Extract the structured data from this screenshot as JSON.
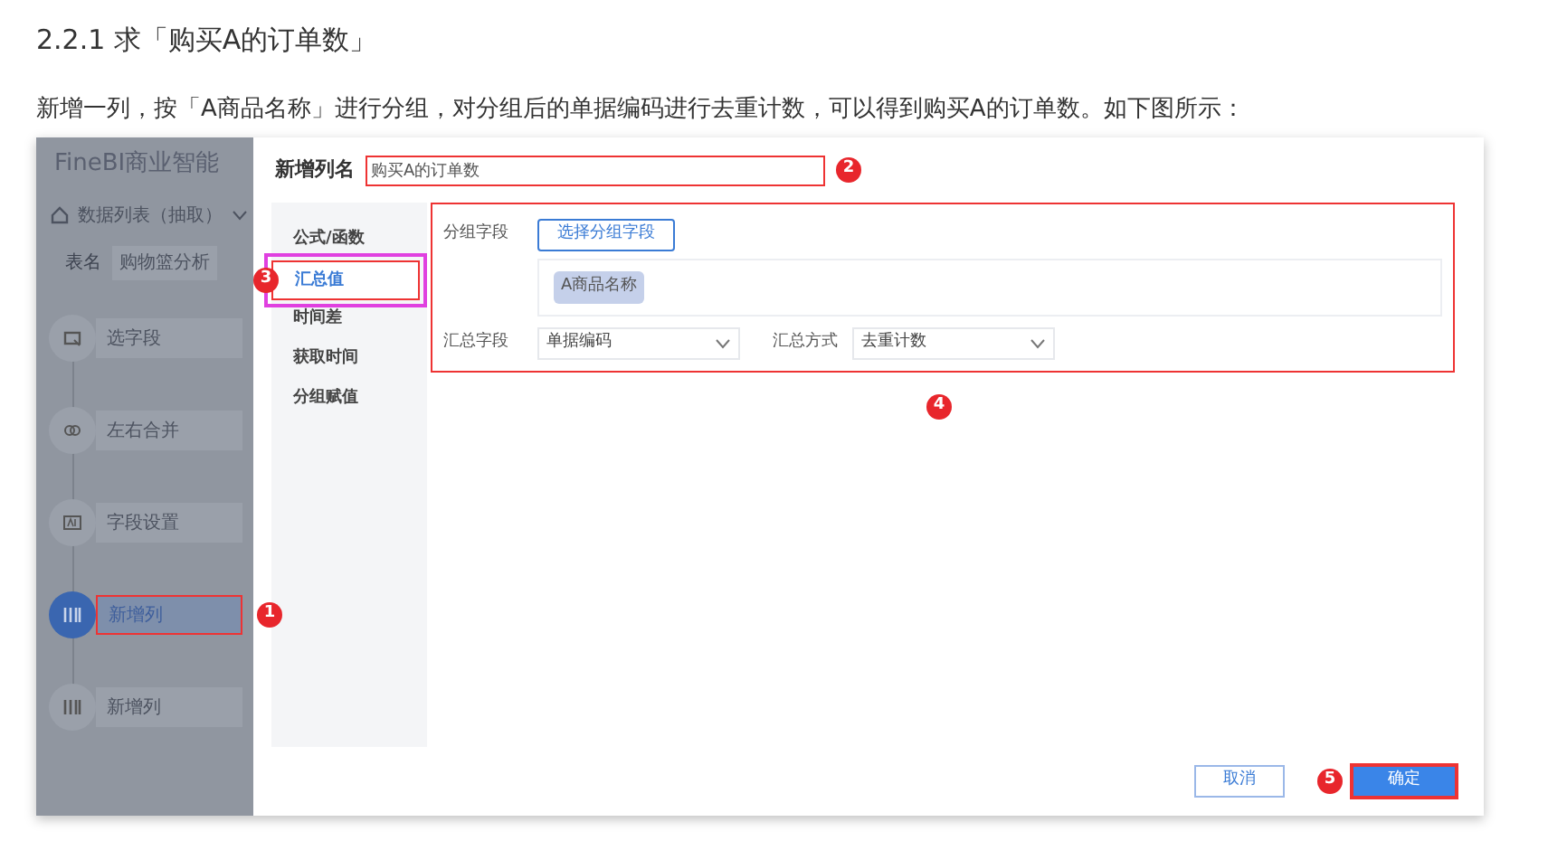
{
  "heading": "2.2.1 求「购买A的订单数」",
  "intro": "新增一列，按「A商品名称」进行分组，对分组后的单据编码进行去重计数，可以得到购买A的订单数。如下图所示：",
  "sidebar": {
    "brand": "FineBI商业智能",
    "dataset": "数据列表（抽取）",
    "table_label": "表名",
    "table_name": "购物篮分析",
    "steps": [
      {
        "label": "选字段",
        "kind": "select",
        "selected": false
      },
      {
        "label": "左右合并",
        "kind": "merge",
        "selected": false
      },
      {
        "label": "字段设置",
        "kind": "settings",
        "selected": false
      },
      {
        "label": "新增列",
        "kind": "column",
        "selected": true,
        "badge": "1"
      },
      {
        "label": "新增列",
        "kind": "column",
        "selected": false
      }
    ]
  },
  "dialog": {
    "name_label": "新增列名",
    "name_value": "购买A的订单数",
    "name_badge": "2",
    "menu": [
      {
        "label": "公式/函数",
        "selected": false
      },
      {
        "label": "汇总值",
        "selected": true
      },
      {
        "label": "时间差",
        "selected": false
      },
      {
        "label": "获取时间",
        "selected": false
      },
      {
        "label": "分组赋值",
        "selected": false
      }
    ],
    "menu_badge": "3",
    "group_label": "分组字段",
    "group_button": "选择分组字段",
    "group_tags": [
      "A商品名称"
    ],
    "sum_field_label": "汇总字段",
    "sum_field_value": "单据编码",
    "sum_method_label": "汇总方式",
    "sum_method_value": "去重计数",
    "panel_badge": "4",
    "cancel": "取消",
    "confirm": "确定",
    "confirm_badge": "5"
  }
}
